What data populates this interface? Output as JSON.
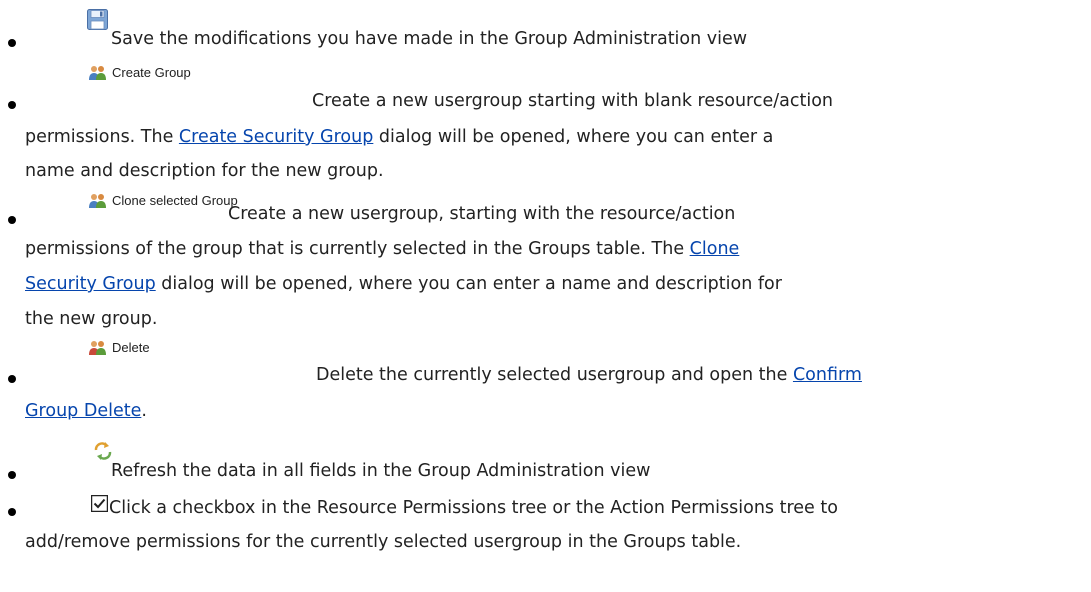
{
  "items": [
    {
      "icon": "save-icon",
      "text": "Save the modifications you have made in the Group Administration view"
    },
    {
      "icon": "create-group-icon",
      "button_label": "Create Group",
      "text_before": "Create a new usergroup starting with blank resource/action",
      "text_line2_before": "permissions. The ",
      "link": "Create Security Group",
      "text_line2_after": " dialog will be opened, where you can enter a",
      "text_line3": "name and description for the new group."
    },
    {
      "icon": "clone-group-icon",
      "button_label": "Clone selected Group",
      "text_before": "Create a new usergroup, starting with the resource/action",
      "text_line2_before": "permissions of the group that is currently selected in the Groups table. The ",
      "link_part1": "Clone",
      "link_part2": "Security Group",
      "text_line3_after": " dialog will be opened, where you can enter a name and description for",
      "text_line4": "the new group."
    },
    {
      "icon": "delete-group-icon",
      "button_label": "Delete",
      "text_before": "Delete the currently selected usergroup and open the ",
      "link_part1": "Confirm",
      "link_part2": "Group Delete",
      "text_after": "."
    },
    {
      "icon": "refresh-icon",
      "text": "Refresh the data in all fields in the Group Administration view"
    },
    {
      "icon": "checkbox-icon",
      "text_line1": "Click a checkbox in the Resource Permissions tree or the Action Permissions tree to",
      "text_line2": "add/remove permissions for the currently selected usergroup in the Groups table."
    }
  ]
}
